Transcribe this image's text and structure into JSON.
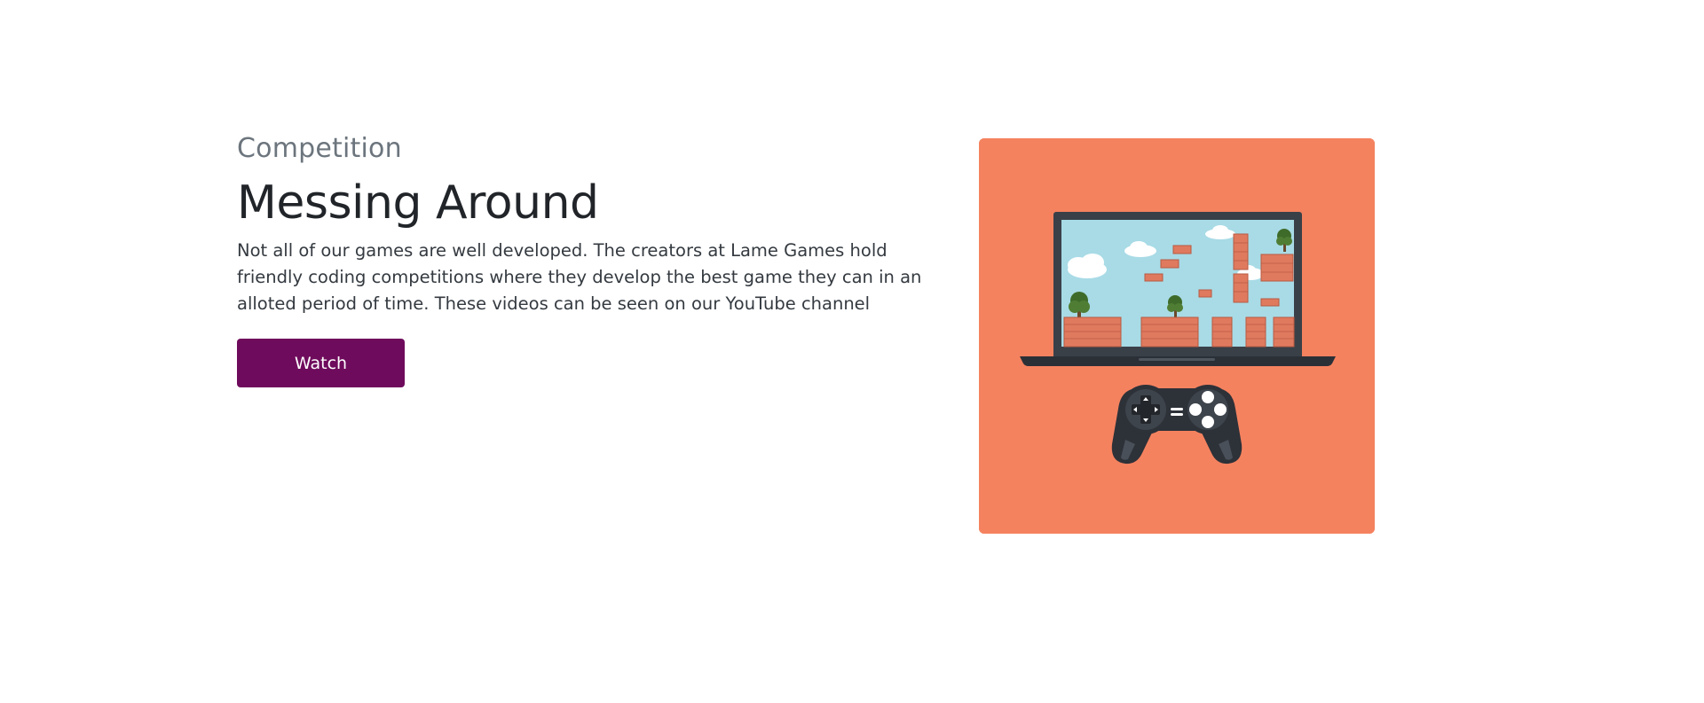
{
  "section": {
    "eyebrow": "Competition",
    "title": "Messing Around",
    "description": "Not all of our games are well developed. The creators at Lame Games hold friendly coding competitions where they develop the best game they can in an alloted period of time. These videos can be seen on our YouTube channel",
    "button_label": "Watch"
  },
  "colors": {
    "button_bg": "#6f0b5c",
    "card_bg": "#f5825f",
    "screen_sky": "#a8dbe6",
    "laptop_frame": "#3a4048",
    "brick": "#e07a5f",
    "controller": "#2d3138"
  },
  "illustration": {
    "icons": [
      "laptop-icon",
      "game-controller-icon",
      "cloud-icon",
      "tree-icon",
      "brick-platform-icon"
    ]
  }
}
